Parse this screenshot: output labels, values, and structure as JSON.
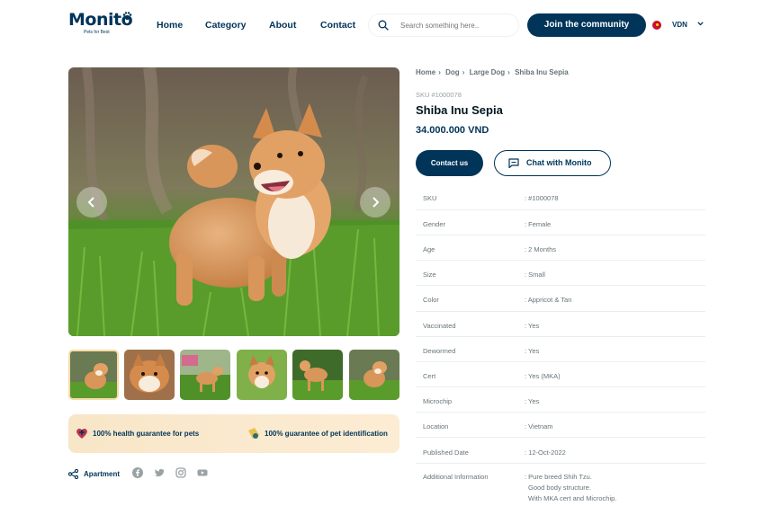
{
  "brand": {
    "name": "Monito",
    "tagline": "Pets for Best"
  },
  "nav": {
    "items": [
      "Home",
      "Category",
      "About",
      "Contact"
    ]
  },
  "search": {
    "placeholder": "Search something here..."
  },
  "header": {
    "join_label": "Join the community",
    "currency": "VDN"
  },
  "breadcrumb": [
    "Home",
    "Dog",
    "Large Dog",
    "Shiba Inu Sepia"
  ],
  "product": {
    "sku_line": "SKU #1000078",
    "title": "Shiba Inu Sepia",
    "price": "34.000.000 VND",
    "contact_label": "Contact us",
    "chat_label": "Chat with Monito"
  },
  "specs": [
    {
      "key": "SKU",
      "value": ": #1000078"
    },
    {
      "key": "Gender",
      "value": ": Female"
    },
    {
      "key": "Age",
      "value": ": 2 Months"
    },
    {
      "key": "Size",
      "value": ": Small"
    },
    {
      "key": "Color",
      "value": ": Appricot & Tan"
    },
    {
      "key": "Vaccinated",
      "value": ": Yes"
    },
    {
      "key": "Dewormed",
      "value": ": Yes"
    },
    {
      "key": "Cert",
      "value": ": Yes (MKA)"
    },
    {
      "key": "Microchip",
      "value": ": Yes"
    },
    {
      "key": "Location",
      "value": ": Vietnam"
    },
    {
      "key": "Published Date",
      "value": ": 12-Oct-2022"
    },
    {
      "key": "Additional Information",
      "value": ": Pure breed Shih Tzu.",
      "extra": [
        "Good body structure.",
        "With MKA cert and Microchip."
      ]
    }
  ],
  "guarantees": [
    "100% health guarantee for pets",
    "100% guarantee of pet identification"
  ],
  "share": {
    "label": "Apartment",
    "networks": [
      "facebook-icon",
      "twitter-icon",
      "instagram-icon",
      "youtube-icon"
    ]
  },
  "colors": {
    "primary": "#003459",
    "accent": "#f7dba7",
    "muted": "#667479"
  }
}
